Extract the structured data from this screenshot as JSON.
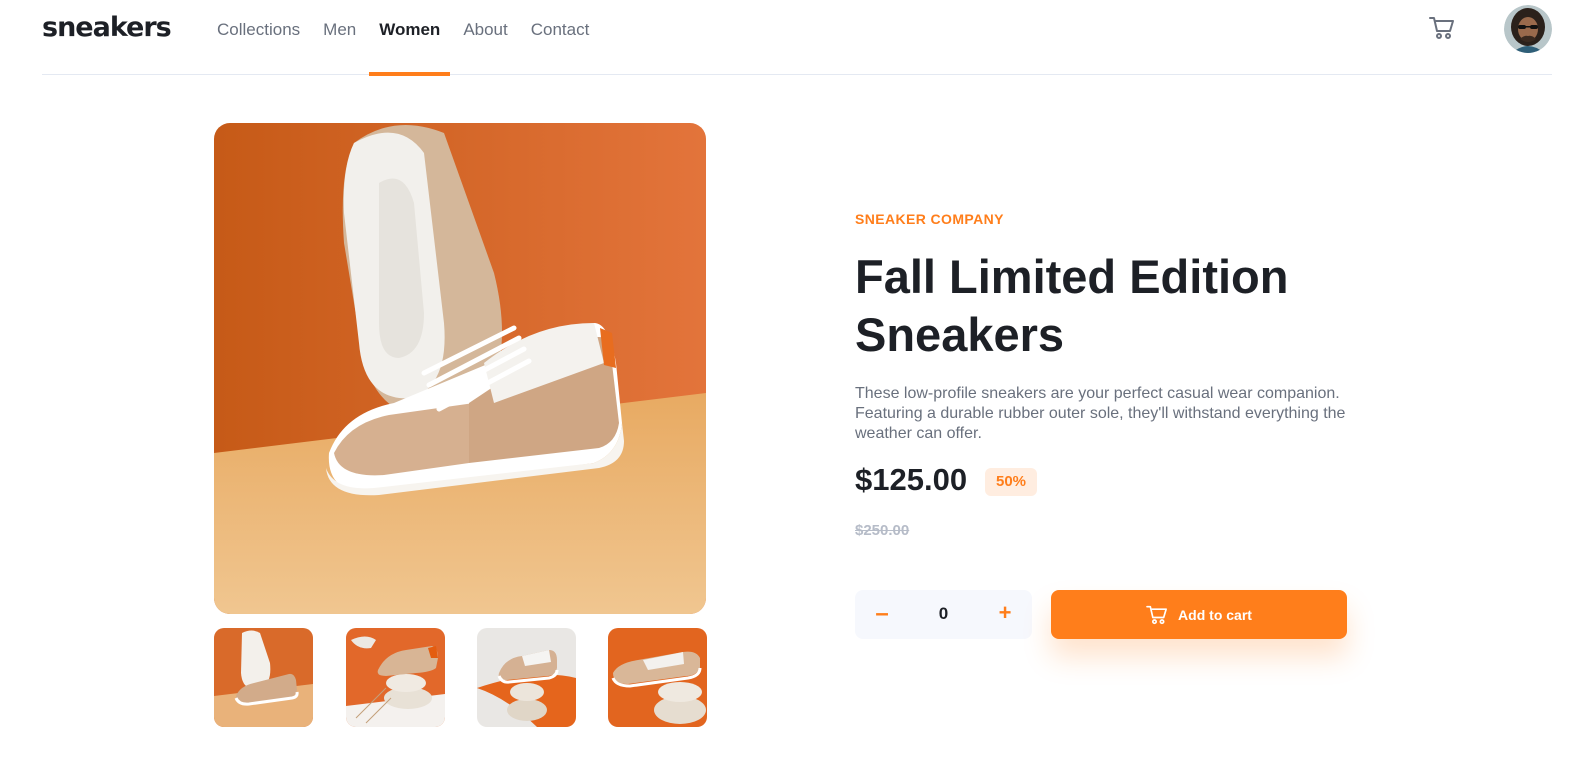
{
  "header": {
    "logo": "sneakers",
    "nav": [
      "Collections",
      "Men",
      "Women",
      "About",
      "Contact"
    ],
    "active_nav": "Women"
  },
  "product": {
    "company": "SNEAKER COMPANY",
    "title": "Fall Limited Edition Sneakers",
    "description": "These low-profile sneakers are your perfect casual wear companion. Featuring a durable rubber outer sole, they'll withstand everything the weather can offer.",
    "price": "$125.00",
    "discount": "50%",
    "old_price": "$250.00",
    "quantity": "0",
    "minus": "–",
    "plus": "+",
    "add_to_cart": "Add to cart"
  },
  "colors": {
    "accent": "#ff7e1b",
    "accent_pale": "#ffede0",
    "text_dark": "#1d2026",
    "text_muted": "#69707d",
    "qty_bg": "#f6f8fd"
  }
}
